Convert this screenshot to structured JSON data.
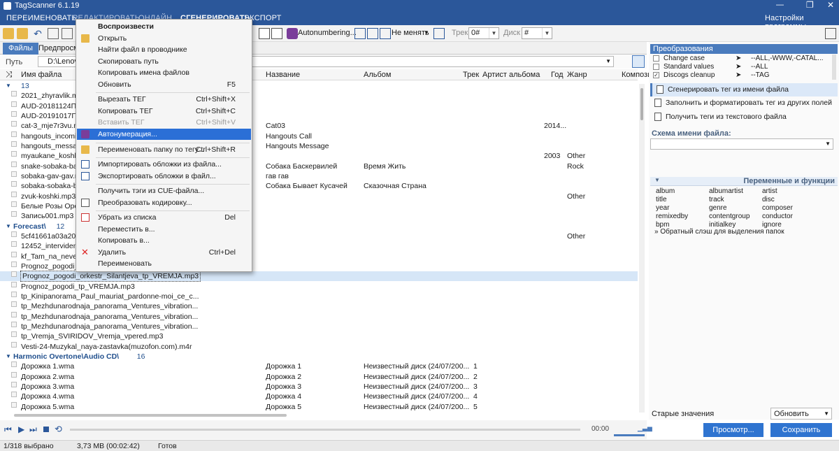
{
  "app": {
    "title": "TagScanner 6.1.19",
    "settings": "Настройки программы"
  },
  "menubar": [
    "ПЕРЕИМЕНОВАТЬ",
    "РЕДАКТИРОВАТЬ",
    "ОНЛАЙН",
    "СГЕНЕРИРОВАТЬ",
    "ЭКСПОРТ"
  ],
  "toolbar": {
    "autonumbering": "Autonumbering...",
    "mode": "Не менять",
    "track_label": "Трек",
    "track_value": "0#",
    "disc_label": "Диск",
    "disc_value": "#"
  },
  "tabs": [
    "Файлы",
    "Предпросмотр"
  ],
  "path": {
    "label": "Путь",
    "value": "D:\\Lenovo"
  },
  "columns": [
    "Имя файла",
    "Название",
    "Альбом",
    "Трек",
    "Артист альбома",
    "Год",
    "Жанр",
    "Компози"
  ],
  "groups": [
    {
      "name": "",
      "count": "13",
      "rows": [
        {
          "file": "2021_zhyravlik.mp3",
          "title": "",
          "album": "",
          "track": "",
          "year": "",
          "genre": ""
        },
        {
          "file": "AUD-20181124ПРО",
          "title": "",
          "album": "",
          "track": "",
          "year": "",
          "genre": ""
        },
        {
          "file": "AUD-20191017ПРО",
          "title": "",
          "album": "",
          "track": "",
          "year": "",
          "genre": ""
        },
        {
          "file": "cat-3_mje7r3vu.mp3",
          "title": "Cat03",
          "album": "",
          "track": "",
          "year": "2014...",
          "genre": ""
        },
        {
          "file": "hangouts_incoming",
          "title": "Hangouts Call",
          "album": "",
          "track": "",
          "year": "",
          "genre": ""
        },
        {
          "file": "hangouts_message.c",
          "title": "Hangouts Message",
          "album": "",
          "track": "",
          "year": "",
          "genre": ""
        },
        {
          "file": "myaukane_koshki_-",
          "title": "",
          "album": "",
          "track": "",
          "year": "2003",
          "genre": "Other"
        },
        {
          "file": "snake-sobaka-baske",
          "title": "Собака Баскервилей",
          "album": "Время Жить",
          "track": "",
          "year": "",
          "genre": "Rock"
        },
        {
          "file": "sobaka-gav-gav.mp",
          "title": "гав гав",
          "album": "",
          "track": "",
          "year": "",
          "genre": ""
        },
        {
          "file": "sobaka-sobaka-byva",
          "title": "Собака Бывает Кусачей",
          "album": "Сказочная Страна",
          "track": "",
          "year": "",
          "genre": ""
        },
        {
          "file": "zvuk-koshki.mp3",
          "title": "",
          "album": "",
          "track": "",
          "year": "",
          "genre": "Other"
        },
        {
          "file": "Белые Розы Оренб",
          "title": "",
          "album": "",
          "track": "",
          "year": "",
          "genre": ""
        },
        {
          "file": "Запись001.mp3",
          "title": "",
          "album": "",
          "track": "",
          "year": "",
          "genre": ""
        }
      ]
    },
    {
      "name": "Forecast\\",
      "count": "12",
      "rows": [
        {
          "file": "5cf41661a03a20d11c",
          "title": "",
          "album": "",
          "track": "",
          "year": "",
          "genre": "Other"
        },
        {
          "file": "12452_intervidenie.m",
          "title": "",
          "album": "",
          "track": "",
          "year": "",
          "genre": ""
        },
        {
          "file": "kf_Tam_na_nevedon",
          "title": "",
          "album": "",
          "track": "",
          "year": "",
          "genre": ""
        },
        {
          "file": "Prognoz_pogodi_Ba",
          "title": "",
          "album": "",
          "track": "",
          "year": "",
          "genre": ""
        },
        {
          "file": "Prognoz_pogodi_orkestr_Silantjeva_tp_VREMJA.mp3",
          "title": "",
          "album": "",
          "track": "",
          "year": "",
          "genre": ""
        },
        {
          "file": "Prognoz_pogodi_tp_VREMJA.mp3",
          "title": "",
          "album": "",
          "track": "",
          "year": "",
          "genre": ""
        },
        {
          "file": "tp_Kinipanorama_Paul_mauriat_pardonne-moi_ce_c...",
          "title": "",
          "album": "",
          "track": "",
          "year": "",
          "genre": ""
        },
        {
          "file": "tp_Mezhdunarodnaja_panorama_Ventures_vibration...",
          "title": "",
          "album": "",
          "track": "",
          "year": "",
          "genre": ""
        },
        {
          "file": "tp_Mezhdunarodnaja_panorama_Ventures_vibration...",
          "title": "",
          "album": "",
          "track": "",
          "year": "",
          "genre": ""
        },
        {
          "file": "tp_Mezhdunarodnaja_panorama_Ventures_vibration...",
          "title": "",
          "album": "",
          "track": "",
          "year": "",
          "genre": ""
        },
        {
          "file": "tp_Vremja_SVIRIDOV_Vremja_vpered.mp3",
          "title": "",
          "album": "",
          "track": "",
          "year": "",
          "genre": ""
        },
        {
          "file": "Vesti-24-Muzykal_naya-zastavka(muzofon.com).m4r",
          "title": "",
          "album": "",
          "track": "",
          "year": "",
          "genre": ""
        }
      ]
    },
    {
      "name": "Harmonic Overtone\\Audio CD\\",
      "count": "16",
      "rows": [
        {
          "file": "Дорожка 1.wma",
          "title": "Дорожка 1",
          "album": "Неизвестный диск (24/07/200...",
          "track": "1",
          "year": "",
          "genre": ""
        },
        {
          "file": "Дорожка 2.wma",
          "title": "Дорожка 2",
          "album": "Неизвестный диск (24/07/200...",
          "track": "2",
          "year": "",
          "genre": ""
        },
        {
          "file": "Дорожка 3.wma",
          "title": "Дорожка 3",
          "album": "Неизвестный диск (24/07/200...",
          "track": "3",
          "year": "",
          "genre": ""
        },
        {
          "file": "Дорожка 4.wma",
          "title": "Дорожка 4",
          "album": "Неизвестный диск (24/07/200...",
          "track": "4",
          "year": "",
          "genre": ""
        },
        {
          "file": "Дорожка 5.wma",
          "title": "Дорожка 5",
          "album": "Неизвестный диск (24/07/200...",
          "track": "5",
          "year": "",
          "genre": ""
        }
      ]
    }
  ],
  "context_menu": [
    {
      "label": "Воспроизвести",
      "shortcut": "",
      "bold": true
    },
    {
      "label": "Открыть",
      "shortcut": "",
      "icon": "folder-icon"
    },
    {
      "label": "Найти файл в проводнике",
      "shortcut": ""
    },
    {
      "label": "Скопировать путь",
      "shortcut": ""
    },
    {
      "label": "Копировать имена файлов",
      "shortcut": ""
    },
    {
      "label": "Обновить",
      "shortcut": "F5"
    },
    {
      "sep": true
    },
    {
      "label": "Вырезать ТЕГ",
      "shortcut": "Ctrl+Shift+X"
    },
    {
      "label": "Копировать ТЕГ",
      "shortcut": "Ctrl+Shift+C"
    },
    {
      "label": "Вставить ТЕГ",
      "shortcut": "Ctrl+Shift+V",
      "disabled": true
    },
    {
      "label": "Автонумерация...",
      "shortcut": "",
      "highlight": true,
      "icon": "autonumber-icon"
    },
    {
      "sep": true
    },
    {
      "label": "Переименовать папку по тегу...",
      "shortcut": "Ctrl+Shift+R",
      "icon": "folder-icon"
    },
    {
      "sep": true
    },
    {
      "label": "Импортировать обложки из файла...",
      "shortcut": "",
      "icon": "import-icon"
    },
    {
      "label": "Экспортировать обложки в файл...",
      "shortcut": "",
      "icon": "export-icon"
    },
    {
      "sep": true
    },
    {
      "label": "Получить тэги из CUE-файла...",
      "shortcut": ""
    },
    {
      "label": "Преобразовать кодировку...",
      "shortcut": "",
      "icon": "document-icon"
    },
    {
      "sep": true
    },
    {
      "label": "Убрать из списка",
      "shortcut": "Del",
      "icon": "remove-icon"
    },
    {
      "label": "Переместить в...",
      "shortcut": ""
    },
    {
      "label": "Копировать в...",
      "shortcut": ""
    },
    {
      "label": "Удалить",
      "shortcut": "Ctrl+Del",
      "icon": "delete-icon"
    },
    {
      "label": "Переименовать",
      "shortcut": ""
    }
  ],
  "right": {
    "transform_title": "Преобразования",
    "transforms": [
      {
        "name": "Change case",
        "value": "--ALL,-WWW,-CATAL..."
      },
      {
        "name": "Standard values",
        "value": "--ALL"
      },
      {
        "name": "Discogs cleanup",
        "value": "--TAG"
      }
    ],
    "buttons": [
      "Сгенерировать тег из имени файла",
      "Заполнить и форматировать тег из других полей",
      "Получить теги из текстового файла"
    ],
    "schema_label": "Схема имени файла:",
    "vars_title": "Переменные и функции",
    "vars": [
      [
        "album",
        "albumartist",
        "artist"
      ],
      [
        "title",
        "track",
        "disc"
      ],
      [
        "year",
        "genre",
        "composer"
      ],
      [
        "remixedby",
        "contentgroup",
        "conductor"
      ],
      [
        "bpm",
        "initialkey",
        "ignore"
      ]
    ],
    "vars_note": "» Обратный слэш для выделения папок",
    "old_values": "Старые значения",
    "refresh": "Обновить",
    "preview": "Просмотр...",
    "save": "Сохранить"
  },
  "player": {
    "time": "00:00"
  },
  "status": {
    "selected": "1/318 выбрано",
    "size": "3,73 MB (00:02:42)",
    "state": "Готов"
  }
}
